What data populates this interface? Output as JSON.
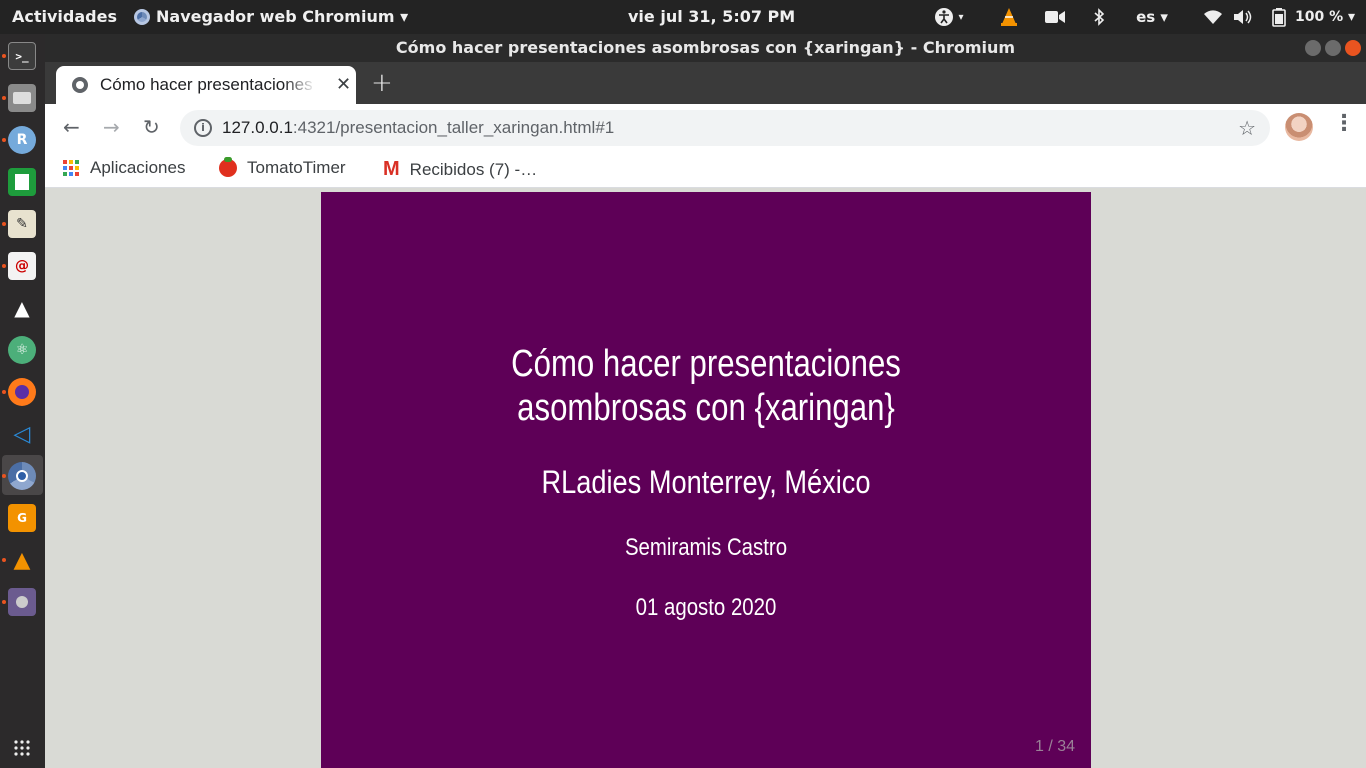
{
  "top_panel": {
    "activities": "Actividades",
    "app_menu": "Navegador web Chromium ▾",
    "clock": "vie jul 31,  5:07 PM",
    "language": "es ▾",
    "battery": "100 % ▾"
  },
  "window": {
    "title": "Cómo hacer presentaciones asombrosas con {xaringan} - Chromium"
  },
  "tab": {
    "label": "Cómo hacer presentaciones asombrosas con {xaringan}",
    "close": "✕",
    "new_tab": "+"
  },
  "toolbar": {
    "back": "←",
    "forward": "→",
    "reload": "↻",
    "url_host": "127.0.0.1",
    "url_rest": ":4321/presentacion_taller_xaringan.html#1",
    "star": "☆",
    "menu": "⋮"
  },
  "bookmarks": [
    {
      "label": "Aplicaciones",
      "icon": "apps-grid-icon"
    },
    {
      "label": "TomatoTimer",
      "icon": "tomato-icon"
    },
    {
      "label": "Recibidos (7) -…",
      "icon": "gmail-icon"
    }
  ],
  "slide": {
    "title": "Cómo hacer presentaciones asombrosas con {xaringan}",
    "subtitle": "RLadies Monterrey, México",
    "author": "Semiramis Castro",
    "date": "01 agosto 2020",
    "page_number": "1 / 34",
    "background_color": "#5e0057"
  },
  "dock": {
    "items": [
      "terminal",
      "files",
      "rstudio",
      "libreoffice-calc",
      "text-editor",
      "evince",
      "inkscape",
      "atom",
      "firefox",
      "vscode",
      "chromium",
      "foxit-pdf",
      "vlc",
      "video-editor"
    ],
    "show_apps": "⋮⋮⋮"
  }
}
